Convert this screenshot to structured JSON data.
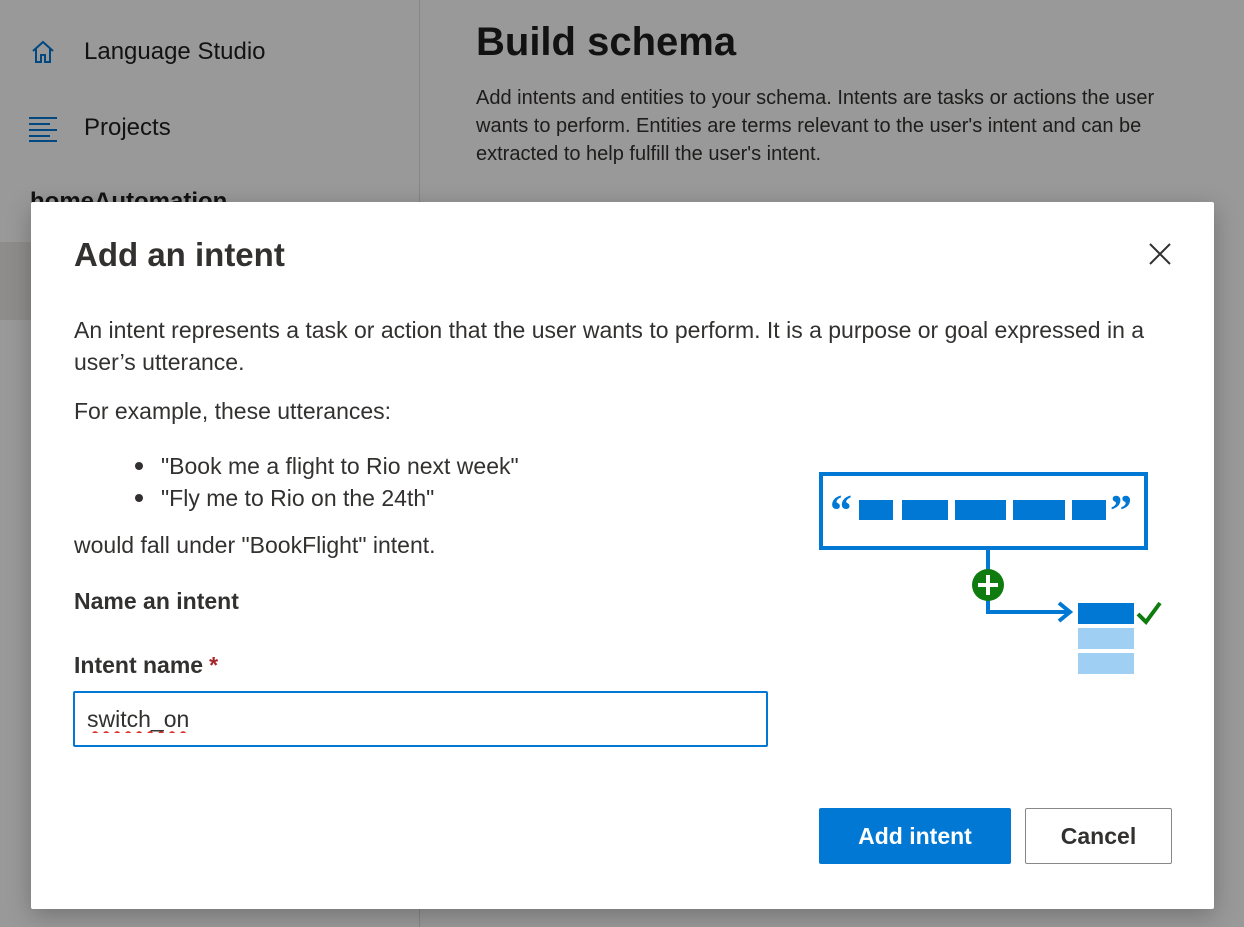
{
  "sidebar": {
    "items": [
      {
        "label": "Language Studio",
        "icon": "home-icon"
      },
      {
        "label": "Projects",
        "icon": "list-icon"
      }
    ],
    "project_name": "homeAutomation"
  },
  "main": {
    "title": "Build schema",
    "description": "Add intents and entities to your schema. Intents are tasks or actions the user wants to perform. Entities are terms relevant to the user's intent and can be extracted to help fulfill the user's intent."
  },
  "dialog": {
    "title": "Add an intent",
    "intro": "An intent represents a task or action that the user wants to perform. It is a purpose or goal expressed in a user’s utterance.",
    "example_intro": "For example, these utterances:",
    "examples": [
      "\"Book me a flight to Rio next week\"",
      "\"Fly me to Rio on the 24th\""
    ],
    "example_outro": "would fall under \"BookFlight\" intent.",
    "section_label": "Name an intent",
    "field_label": "Intent name",
    "required_mark": "*",
    "field_value": "switch_on",
    "primary_button": "Add intent",
    "secondary_button": "Cancel",
    "icons": {
      "close": "close-icon",
      "illustration": "intent-illustration"
    }
  },
  "colors": {
    "accent": "#0078d4",
    "required": "#a4262c",
    "success": "#107c10"
  }
}
